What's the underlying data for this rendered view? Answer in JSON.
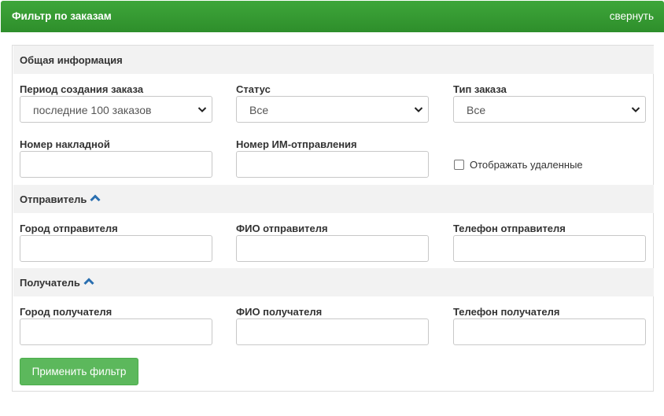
{
  "header": {
    "title": "Фильтр по заказам",
    "collapse_link": "свернуть"
  },
  "sections": {
    "general": {
      "title": "Общая информация"
    },
    "sender": {
      "title": "Отправитель",
      "toggle_icon": "chevron-up-icon"
    },
    "recipient": {
      "title": "Получатель",
      "toggle_icon": "chevron-up-icon"
    }
  },
  "general": {
    "period": {
      "label": "Период создания заказа",
      "value": "последние 100 заказов"
    },
    "status": {
      "label": "Статус",
      "value": "Все"
    },
    "order_type": {
      "label": "Тип заказа",
      "value": "Все"
    },
    "waybill": {
      "label": "Номер накладной",
      "value": ""
    },
    "im_shipment": {
      "label": "Номер ИМ-отправления",
      "value": ""
    },
    "show_deleted": {
      "label": "Отображать удаленные",
      "checked": false
    }
  },
  "sender": {
    "city": {
      "label": "Город отправителя",
      "value": ""
    },
    "name": {
      "label": "ФИО отправителя",
      "value": ""
    },
    "phone": {
      "label": "Телефон отправителя",
      "value": ""
    }
  },
  "recipient": {
    "city": {
      "label": "Город получателя",
      "value": ""
    },
    "name": {
      "label": "ФИО получателя",
      "value": ""
    },
    "phone": {
      "label": "Телефон получателя",
      "value": ""
    }
  },
  "actions": {
    "apply_label": "Применить фильтр"
  },
  "colors": {
    "header_green": "#3ea63a",
    "button_green": "#5cb85c",
    "chevron_blue": "#2a6fb0",
    "section_bg": "#f2f2f2"
  }
}
